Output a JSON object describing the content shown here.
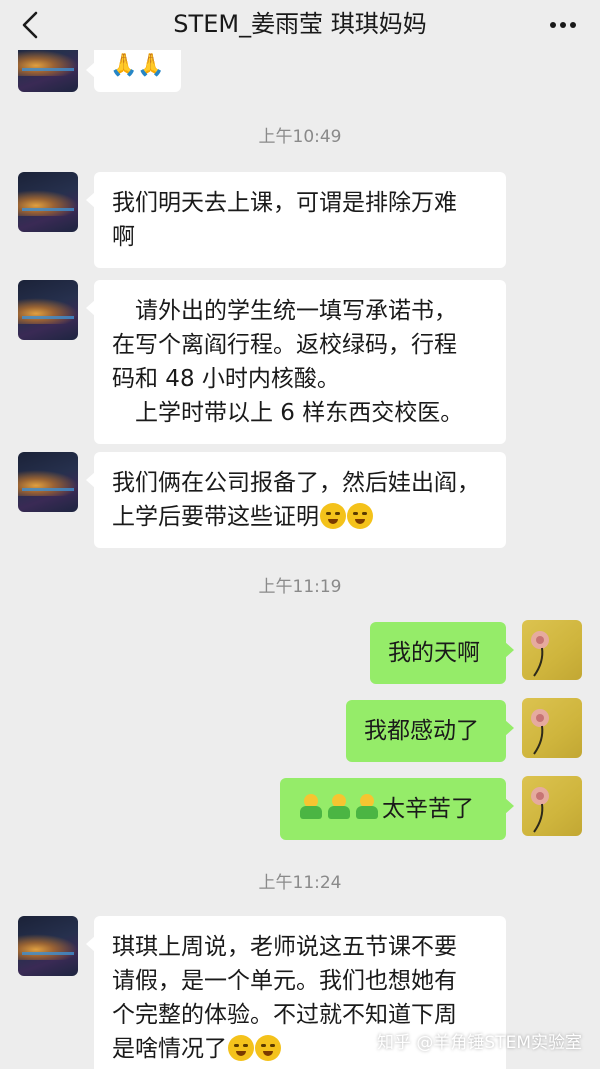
{
  "header": {
    "title": "STEM_姜雨莹 琪琪妈妈",
    "back_icon": "chevron-left-icon",
    "more_icon": "more-dots-icon"
  },
  "messages": [
    {
      "side": "left",
      "content": "🙏🙏",
      "type": "emoji-only"
    },
    {
      "time": "上午10:49"
    },
    {
      "side": "left",
      "lines": [
        "我们明天去上课，可谓是排除万难",
        "啊"
      ]
    },
    {
      "side": "left",
      "lines": [
        "　请外出的学生统一填写承诺书，",
        "在写个离阎行程。返校绿码，行程",
        "码和 48 小时内核酸。",
        "　上学时带以上 6 样东西交校医。"
      ]
    },
    {
      "side": "left",
      "lines": [
        "我们俩在公司报备了，然后娃出阎，",
        "上学后要带这些证明"
      ],
      "trailing_emoji": "crying-laughing-emoji x2"
    },
    {
      "time": "上午11:19"
    },
    {
      "side": "right",
      "lines": [
        "我的天啊"
      ]
    },
    {
      "side": "right",
      "lines": [
        "我都感动了"
      ]
    },
    {
      "side": "right",
      "lines": [
        "太辛苦了"
      ],
      "leading_emoji": "hug-emoji x3"
    },
    {
      "time": "上午11:24"
    },
    {
      "side": "left",
      "lines": [
        "琪琪上周说，老师说这五节课不要",
        "请假，是一个单元。我们也想她有",
        "个完整的体验。不过就不知道下周",
        "是啥情况了"
      ],
      "trailing_emoji": "crying-laughing-emoji x2"
    }
  ],
  "watermark": "知乎 @羊角锤STEM实验室"
}
